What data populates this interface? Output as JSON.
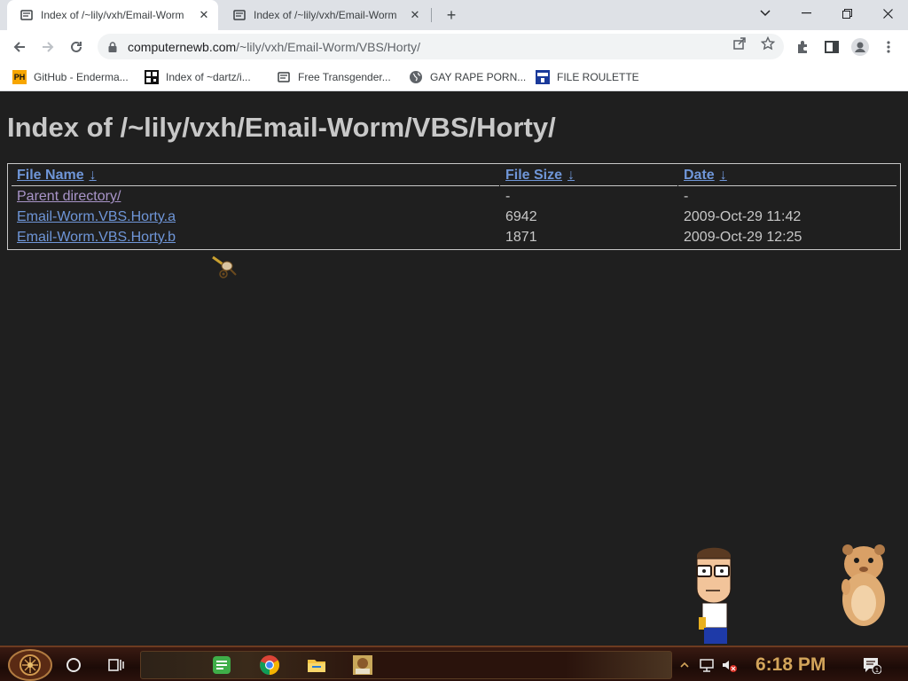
{
  "browser": {
    "tabs": [
      {
        "title": "Index of /~lily/vxh/Email-Worm",
        "active": true
      },
      {
        "title": "Index of /~lily/vxh/Email-Worm",
        "active": false
      }
    ],
    "url_host": "computernewb.com",
    "url_path": "/~lily/vxh/Email-Worm/VBS/Horty/",
    "bookmarks": [
      {
        "label": "GitHub - Enderma...",
        "icon": "ph-logo-icon"
      },
      {
        "label": "Index of ~dartz/i...",
        "icon": "qr-favicon-icon"
      },
      {
        "label": "Free Transgender...",
        "icon": "site-favicon-icon"
      },
      {
        "label": "GAY RAPE PORN...",
        "icon": "globe-icon"
      },
      {
        "label": "FILE ROULETTE",
        "icon": "mft-favicon-icon"
      }
    ]
  },
  "page": {
    "heading": "Index of /~lily/vxh/Email-Worm/VBS/Horty/",
    "columns": {
      "name": "File Name",
      "size": "File Size",
      "date": "Date",
      "sort_arrow": "↓"
    },
    "rows": [
      {
        "name": "Parent directory/",
        "size": "-",
        "date": "-"
      },
      {
        "name": "Email-Worm.VBS.Horty.a",
        "size": "6942",
        "date": "2009-Oct-29 11:42"
      },
      {
        "name": "Email-Worm.VBS.Horty.b",
        "size": "1871",
        "date": "2009-Oct-29 12:25"
      }
    ]
  },
  "taskbar": {
    "clock": "6:18 PM",
    "accent": "#d2a45a"
  },
  "colors": {
    "page_bg": "#1f1f1f",
    "text": "#c8c8c8",
    "link": "#6f96d8",
    "visited_link": "#a995c9"
  }
}
